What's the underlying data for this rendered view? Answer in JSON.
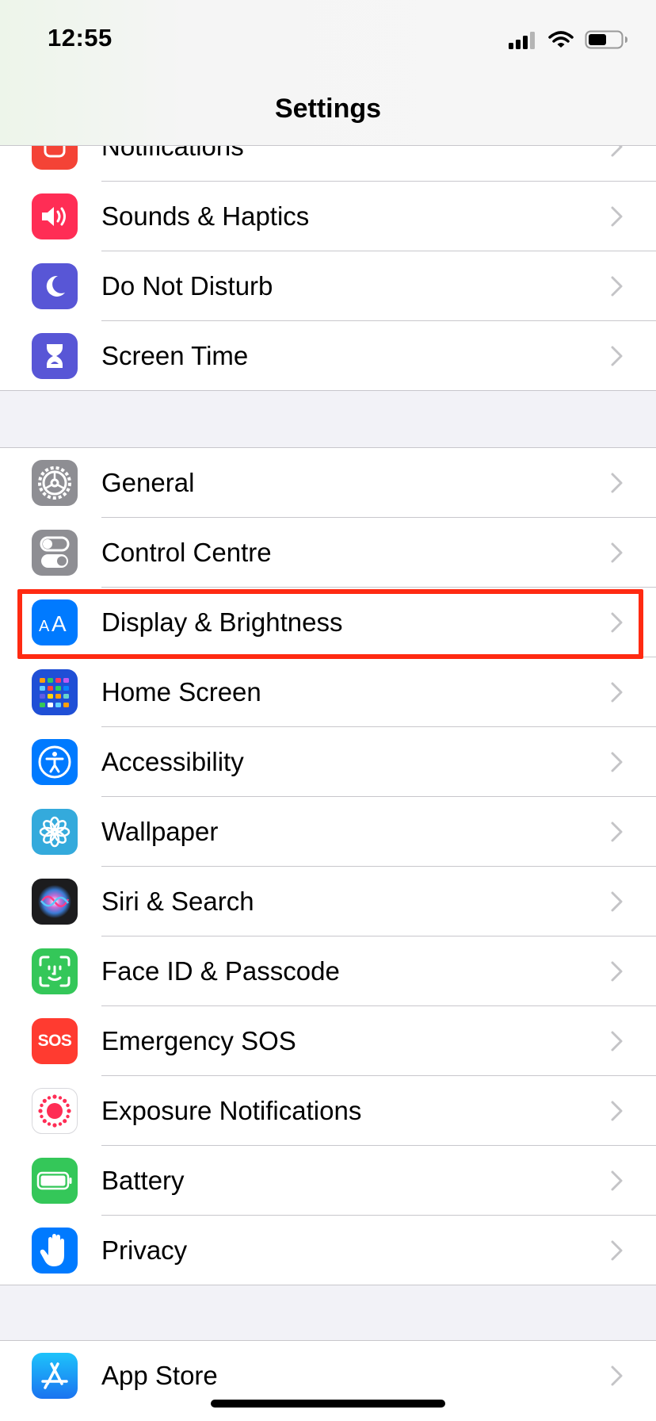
{
  "status_bar": {
    "time": "12:55"
  },
  "nav": {
    "title": "Settings"
  },
  "colors": {
    "notifications": "#f44336",
    "sounds": "#ff2d55",
    "do_not_disturb": "#5856d6",
    "screen_time": "#5856d6",
    "general": "#8e8e93",
    "control_centre": "#8e8e93",
    "display": "#007aff",
    "home_screen": "#1f4fd6",
    "accessibility": "#007aff",
    "wallpaper": "#34aadc",
    "siri": "#1c1c1e",
    "face_id": "#34c759",
    "sos": "#ff3b30",
    "exposure": "#ffffff",
    "battery": "#34c759",
    "privacy": "#007aff",
    "app_store": "#1a8cff",
    "highlight": "#ff2a12"
  },
  "groups": [
    {
      "items": [
        {
          "label": "Notifications",
          "icon": "bell-icon"
        },
        {
          "label": "Sounds & Haptics",
          "icon": "speaker-icon"
        },
        {
          "label": "Do Not Disturb",
          "icon": "moon-icon"
        },
        {
          "label": "Screen Time",
          "icon": "hourglass-icon"
        }
      ]
    },
    {
      "items": [
        {
          "label": "General",
          "icon": "gear-icon"
        },
        {
          "label": "Control Centre",
          "icon": "toggles-icon"
        },
        {
          "label": "Display & Brightness",
          "icon": "text-size-icon",
          "highlighted": true
        },
        {
          "label": "Home Screen",
          "icon": "app-grid-icon"
        },
        {
          "label": "Accessibility",
          "icon": "accessibility-icon"
        },
        {
          "label": "Wallpaper",
          "icon": "flower-icon"
        },
        {
          "label": "Siri & Search",
          "icon": "siri-icon"
        },
        {
          "label": "Face ID & Passcode",
          "icon": "face-id-icon"
        },
        {
          "label": "Emergency SOS",
          "icon": "sos-icon",
          "icon_text": "SOS"
        },
        {
          "label": "Exposure Notifications",
          "icon": "exposure-icon"
        },
        {
          "label": "Battery",
          "icon": "battery-icon"
        },
        {
          "label": "Privacy",
          "icon": "hand-icon"
        }
      ]
    },
    {
      "items": [
        {
          "label": "App Store",
          "icon": "app-store-icon"
        }
      ]
    }
  ]
}
